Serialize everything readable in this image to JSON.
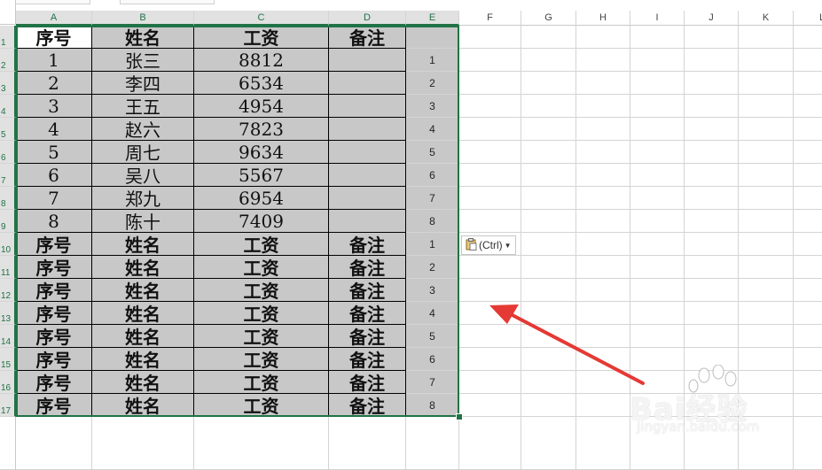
{
  "sheet": {
    "columns": [
      "A",
      "B",
      "C",
      "D",
      "E",
      "F",
      "G",
      "H",
      "I",
      "J",
      "K",
      "L"
    ],
    "rows": [
      "1",
      "2",
      "3",
      "4",
      "5",
      "6",
      "7",
      "8",
      "9",
      "10",
      "11",
      "12",
      "13",
      "14",
      "15",
      "16",
      "17"
    ],
    "header_row": [
      "序号",
      "姓名",
      "工资",
      "备注"
    ],
    "data_rows": [
      [
        "1",
        "张三",
        "8812",
        ""
      ],
      [
        "2",
        "李四",
        "6534",
        ""
      ],
      [
        "3",
        "王五",
        "4954",
        ""
      ],
      [
        "4",
        "赵六",
        "7823",
        ""
      ],
      [
        "5",
        "周七",
        "9634",
        ""
      ],
      [
        "6",
        "吴八",
        "5567",
        ""
      ],
      [
        "7",
        "郑九",
        "6954",
        ""
      ],
      [
        "8",
        "陈十",
        "7409",
        ""
      ]
    ],
    "helper_column_E": [
      "",
      "1",
      "2",
      "3",
      "4",
      "5",
      "6",
      "7",
      "8",
      "1",
      "2",
      "3",
      "4",
      "5",
      "6",
      "7",
      "8"
    ],
    "selection_color": "#217346",
    "selected_fill": "#c8c8c8"
  },
  "paste_options": {
    "label": "(Ctrl)",
    "icon": "clipboard-icon",
    "dropdown_icon": "caret-down-icon"
  },
  "annotation": {
    "arrow_color": "#e53935"
  },
  "watermark": {
    "brand": "Bai经验",
    "url": "jingyan.baidu.com"
  }
}
